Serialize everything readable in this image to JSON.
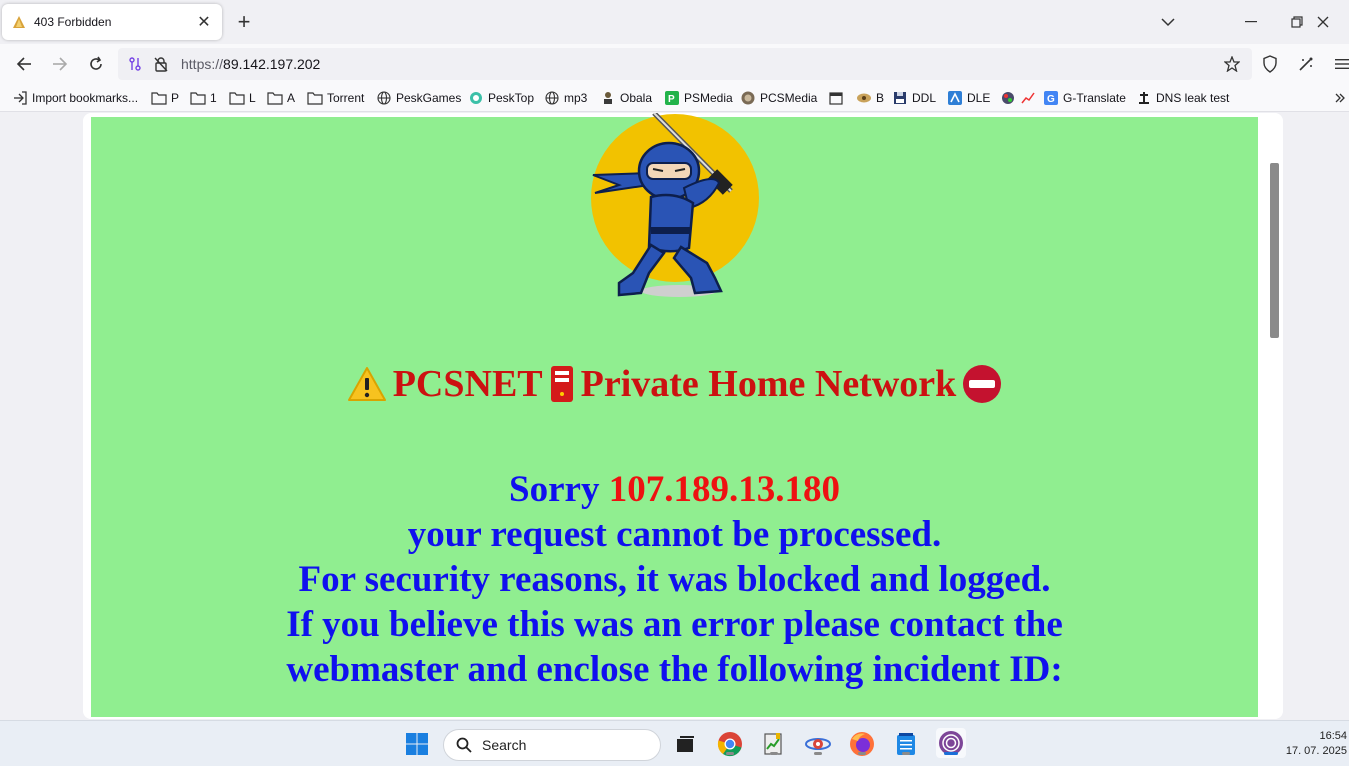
{
  "tab": {
    "title": "403 Forbidden"
  },
  "url": {
    "scheme": "https://",
    "host": "89.142.197.202"
  },
  "bookmarks": [
    {
      "label": "Import bookmarks...",
      "icon": "import-icon"
    },
    {
      "label": "P",
      "icon": "folder-icon"
    },
    {
      "label": "1",
      "icon": "folder-icon"
    },
    {
      "label": "L",
      "icon": "folder-icon"
    },
    {
      "label": "A",
      "icon": "folder-icon"
    },
    {
      "label": "Torrent",
      "icon": "folder-icon"
    },
    {
      "label": "PeskGames",
      "icon": "globe-icon"
    },
    {
      "label": "PeskTop",
      "icon": "peskTop-icon"
    },
    {
      "label": "mp3",
      "icon": "globe-icon"
    },
    {
      "label": "Obala",
      "icon": "obala-icon"
    },
    {
      "label": "PSMedia",
      "icon": "psmedia-icon"
    },
    {
      "label": "PCSMedia",
      "icon": "pcsmedia-icon"
    },
    {
      "label": "",
      "icon": "calendar-icon"
    },
    {
      "label": "B",
      "icon": "b-icon"
    },
    {
      "label": "DDL",
      "icon": "floppy-icon"
    },
    {
      "label": "DLE",
      "icon": "dle-icon"
    },
    {
      "label": "",
      "icon": "chart-icon"
    },
    {
      "label": "G-Translate",
      "icon": "translate-icon"
    },
    {
      "label": "DNS leak test",
      "icon": "dns-icon"
    }
  ],
  "page": {
    "heading": "PCSNET",
    "heading2": "Private Home Network",
    "sorry": "Sorry",
    "ip": "107.189.13.180",
    "line2": "your request cannot be processed.",
    "line3": "For security reasons, it was blocked and logged.",
    "line4": "If you believe this was an error please contact the",
    "line5": "webmaster and enclose the following incident ID:"
  },
  "taskbar": {
    "search_placeholder": "Search",
    "time": "16:54",
    "date": "17. 07. 2025"
  },
  "colors": {
    "page_bg": "#90ee90",
    "heading": "#cc1111",
    "message": "#1010ee",
    "ip": "#ee1111"
  }
}
